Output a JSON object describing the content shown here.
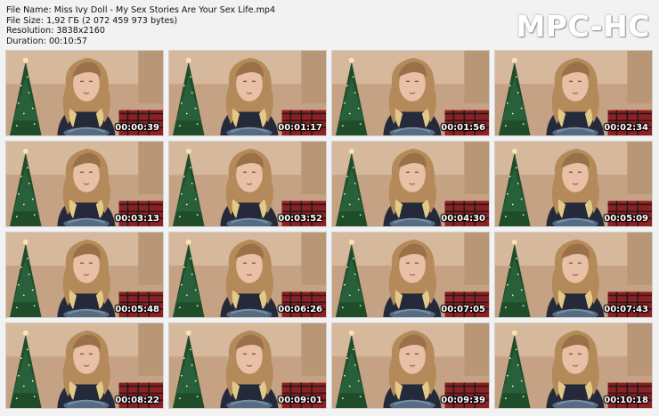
{
  "header": {
    "file_name": "File Name: Miss Ivy Doll - My Sex Stories Are Your Sex Life.mp4",
    "file_size": "File Size: 1,92 ГБ (2 072 459 973 bytes)",
    "resolution": "Resolution: 3838x2160",
    "duration": "Duration: 00:10:57"
  },
  "logo": "MPC-HC",
  "thumbnails": [
    {
      "timestamp": "00:00:39"
    },
    {
      "timestamp": "00:01:17"
    },
    {
      "timestamp": "00:01:56"
    },
    {
      "timestamp": "00:02:34"
    },
    {
      "timestamp": "00:03:13"
    },
    {
      "timestamp": "00:03:52"
    },
    {
      "timestamp": "00:04:30"
    },
    {
      "timestamp": "00:05:09"
    },
    {
      "timestamp": "00:05:48"
    },
    {
      "timestamp": "00:06:26"
    },
    {
      "timestamp": "00:07:05"
    },
    {
      "timestamp": "00:07:43"
    },
    {
      "timestamp": "00:08:22"
    },
    {
      "timestamp": "00:09:01"
    },
    {
      "timestamp": "00:09:39"
    },
    {
      "timestamp": "00:10:18"
    }
  ]
}
